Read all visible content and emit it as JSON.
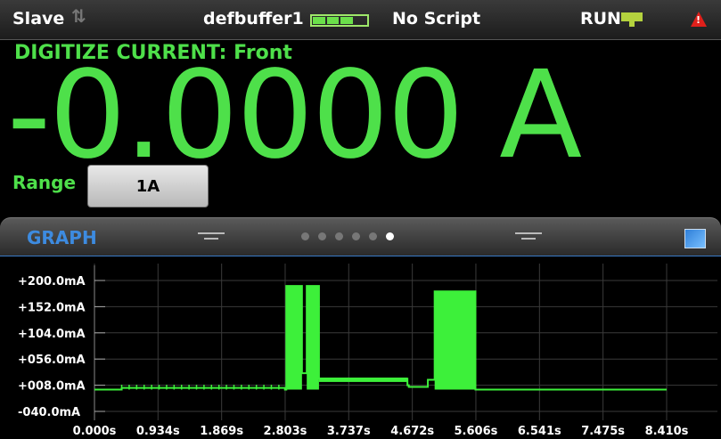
{
  "status_bar": {
    "mode": "Slave",
    "buffer_name": "defbuffer1",
    "buffer_fill_segments": 3,
    "buffer_total_segments": 4,
    "script": "No Script",
    "run_state": "RUN",
    "run_indicator_color": "#b4d23e",
    "warning_color": "#e0201b"
  },
  "function": "DIGITIZE CURRENT: Front",
  "reading": "-0.0000 A",
  "range": {
    "label": "Range",
    "value": "1A"
  },
  "graph_panel": {
    "title": "GRAPH",
    "pages": 6,
    "active_page": 6
  },
  "colors": {
    "accent_green": "#4ee04a",
    "trace": "#3df03a",
    "graph_title": "#3d8be0"
  },
  "chart_data": {
    "type": "line",
    "y_tick_labels": [
      "+200.0mA",
      "+152.0mA",
      "+104.0mA",
      "+056.0mA",
      "+008.0mA",
      "-040.0mA"
    ],
    "y_ticks": [
      200,
      152,
      104,
      56,
      8,
      -40
    ],
    "ylim": [
      -40,
      200
    ],
    "x_tick_labels": [
      "0.000s",
      "0.934s",
      "1.869s",
      "2.803s",
      "3.737s",
      "4.672s",
      "5.606s",
      "6.541s",
      "7.475s",
      "8.410s"
    ],
    "x_ticks": [
      0,
      0.934,
      1.869,
      2.803,
      3.737,
      4.672,
      5.606,
      6.541,
      7.475,
      8.41
    ],
    "xlim": [
      0,
      8.41
    ],
    "grid": true,
    "series": [
      {
        "x": [
          0,
          0.4,
          0.4,
          2.8,
          2.8,
          2.82,
          2.82,
          3.05,
          3.05,
          3.12,
          3.12,
          3.3,
          3.3,
          3.4,
          3.4,
          4.6,
          4.6,
          4.62,
          4.62,
          4.9,
          4.9,
          5.0,
          5.0,
          5.6,
          5.6,
          6.3,
          6.3,
          8.41
        ],
        "y": [
          0,
          0,
          3,
          3,
          0,
          0,
          190,
          190,
          30,
          30,
          190,
          190,
          20,
          20,
          20,
          20,
          8,
          8,
          5,
          5,
          18,
          18,
          180,
          180,
          0,
          0,
          0,
          0
        ]
      }
    ]
  }
}
